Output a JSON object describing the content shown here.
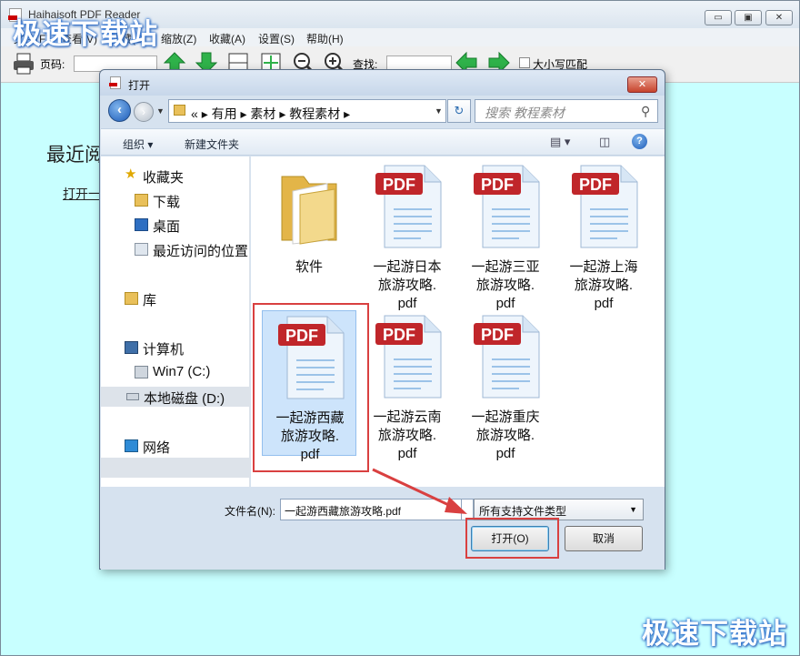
{
  "app": {
    "title": "Haihaisoft PDF Reader",
    "window_buttons": {
      "minimize": "▭",
      "maximize": "▣",
      "close": "✕"
    },
    "menus": [
      "文件(F)",
      "查看(V)",
      "收藏(S)",
      "缩放(Z)",
      "收藏(A)",
      "设置(S)",
      "帮助(H)"
    ],
    "toolbar": {
      "page_label": "页码:",
      "find_label": "查找:",
      "match_case_label": "大小写匹配"
    },
    "body": {
      "recent_title": "最近阅",
      "open_link": "打开一"
    }
  },
  "watermark": {
    "text": "极速下载站"
  },
  "dialog": {
    "title": "打开",
    "close_label": "✕",
    "breadcrumb": [
      "«",
      "有用",
      "素材",
      "教程素材"
    ],
    "search_placeholder": "搜索 教程素材",
    "commands": {
      "organize": "组织 ▾",
      "new_folder": "新建文件夹"
    },
    "nav": {
      "favorites": "收藏夹",
      "downloads": "下载",
      "desktop": "桌面",
      "recent_places": "最近访问的位置",
      "libraries": "库",
      "computer": "计算机",
      "drive_c": "Win7 (C:)",
      "drive_d": "本地磁盘 (D:)",
      "network": "网络"
    },
    "files": [
      {
        "type": "folder",
        "lines": [
          "软件"
        ]
      },
      {
        "type": "pdf",
        "lines": [
          "一起游日本",
          "旅游攻略.",
          "pdf"
        ]
      },
      {
        "type": "pdf",
        "lines": [
          "一起游三亚",
          "旅游攻略.",
          "pdf"
        ]
      },
      {
        "type": "pdf",
        "lines": [
          "一起游上海",
          "旅游攻略.",
          "pdf"
        ]
      },
      {
        "type": "pdf",
        "lines": [
          "一起游西藏",
          "旅游攻略.",
          "pdf"
        ],
        "selected": true
      },
      {
        "type": "pdf",
        "lines": [
          "一起游云南",
          "旅游攻略.",
          "pdf"
        ]
      },
      {
        "type": "pdf",
        "lines": [
          "一起游重庆",
          "旅游攻略.",
          "pdf"
        ]
      }
    ],
    "pdf_badge": "PDF",
    "filename_label": "文件名(N):",
    "filename_value": "一起游西藏旅游攻略.pdf",
    "filetype_value": "所有支持文件类型",
    "open_button": "打开(O)",
    "cancel_button": "取消"
  },
  "colors": {
    "app_background": "#c8ffff",
    "annotation_red": "#d94040",
    "pdf_badge_red": "#c0262a",
    "selection_blue": "#cde4fb"
  }
}
